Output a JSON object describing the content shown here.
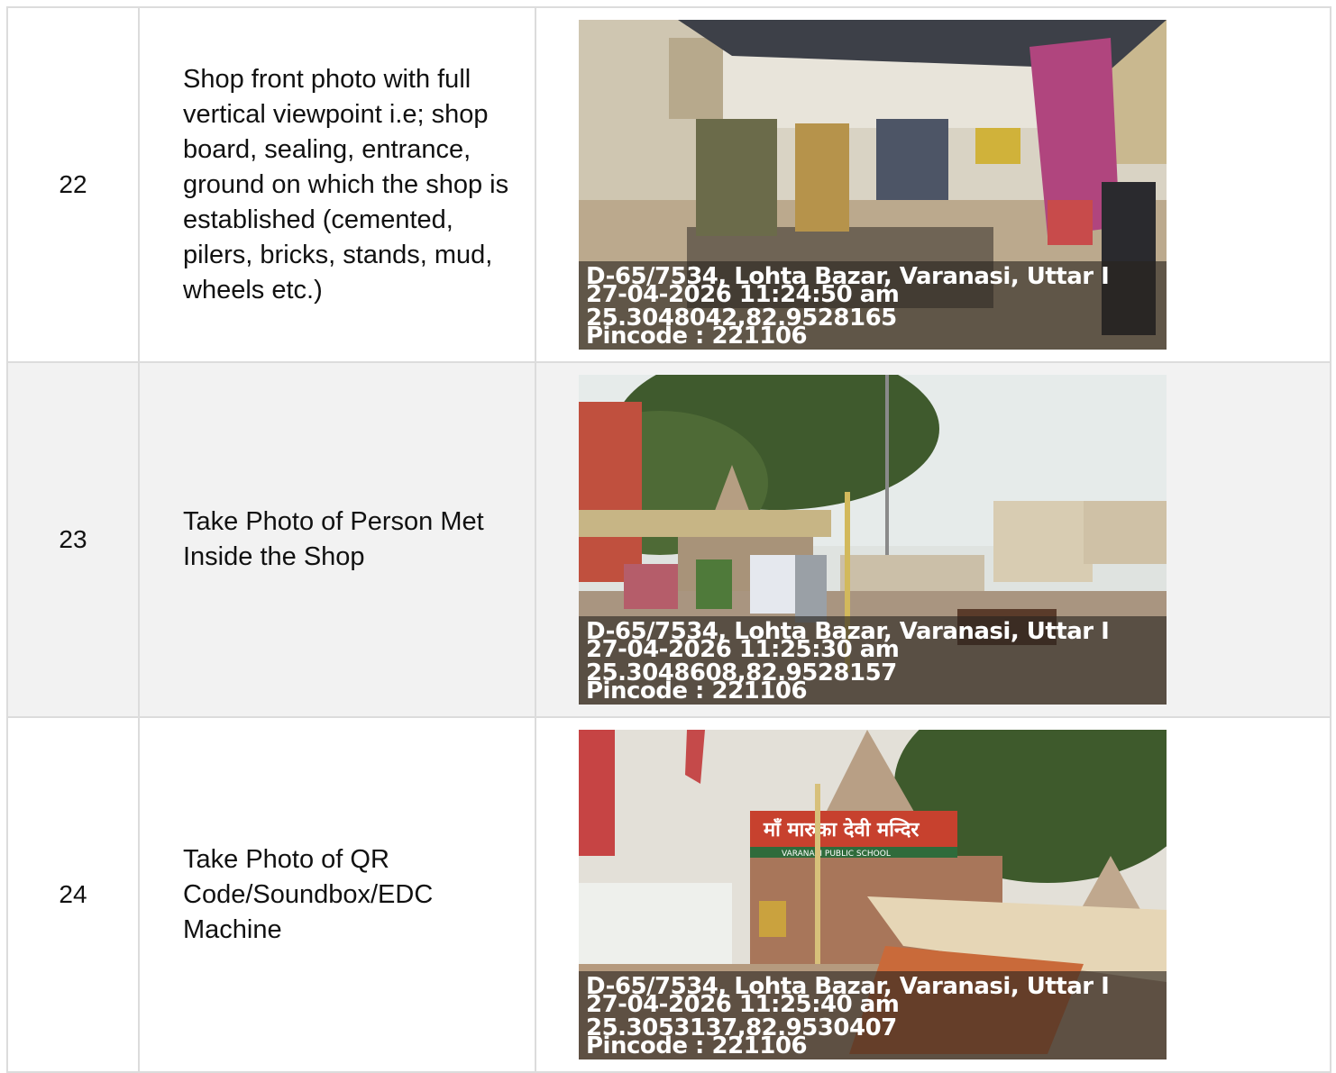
{
  "rows": [
    {
      "number": "22",
      "description": "Shop front photo with full vertical viewpoint i.e; shop board, sealing, entrance, ground on which the shop is established (cemented, pilers, bricks, stands, mud, wheels etc.)",
      "photo": {
        "address": "D-65/7534, Lohta Bazar, Varanasi, Uttar I",
        "datetime": "27-04-2026 11:24:50 am",
        "coords": "25.3048042,82.9528165",
        "pincode": "Pincode : 221106"
      }
    },
    {
      "number": "23",
      "description": "Take Photo of Person Met Inside the Shop",
      "photo": {
        "address": "D-65/7534, Lohta Bazar, Varanasi, Uttar I",
        "datetime": "27-04-2026 11:25:30 am",
        "coords": "25.3048608,82.9528157",
        "pincode": "Pincode : 221106"
      }
    },
    {
      "number": "24",
      "description": "Take Photo of QR Code/Soundbox/EDC Machine",
      "photo": {
        "address": "D-65/7534, Lohta Bazar, Varanasi, Uttar I",
        "datetime": "27-04-2026 11:25:40 am",
        "coords": "25.3053137,82.9530407",
        "pincode": "Pincode : 221106",
        "sign_text": "माँ मारुका देवी मन्दिर",
        "sign_subtext": "VARANASI PUBLIC SCHOOL"
      }
    }
  ]
}
